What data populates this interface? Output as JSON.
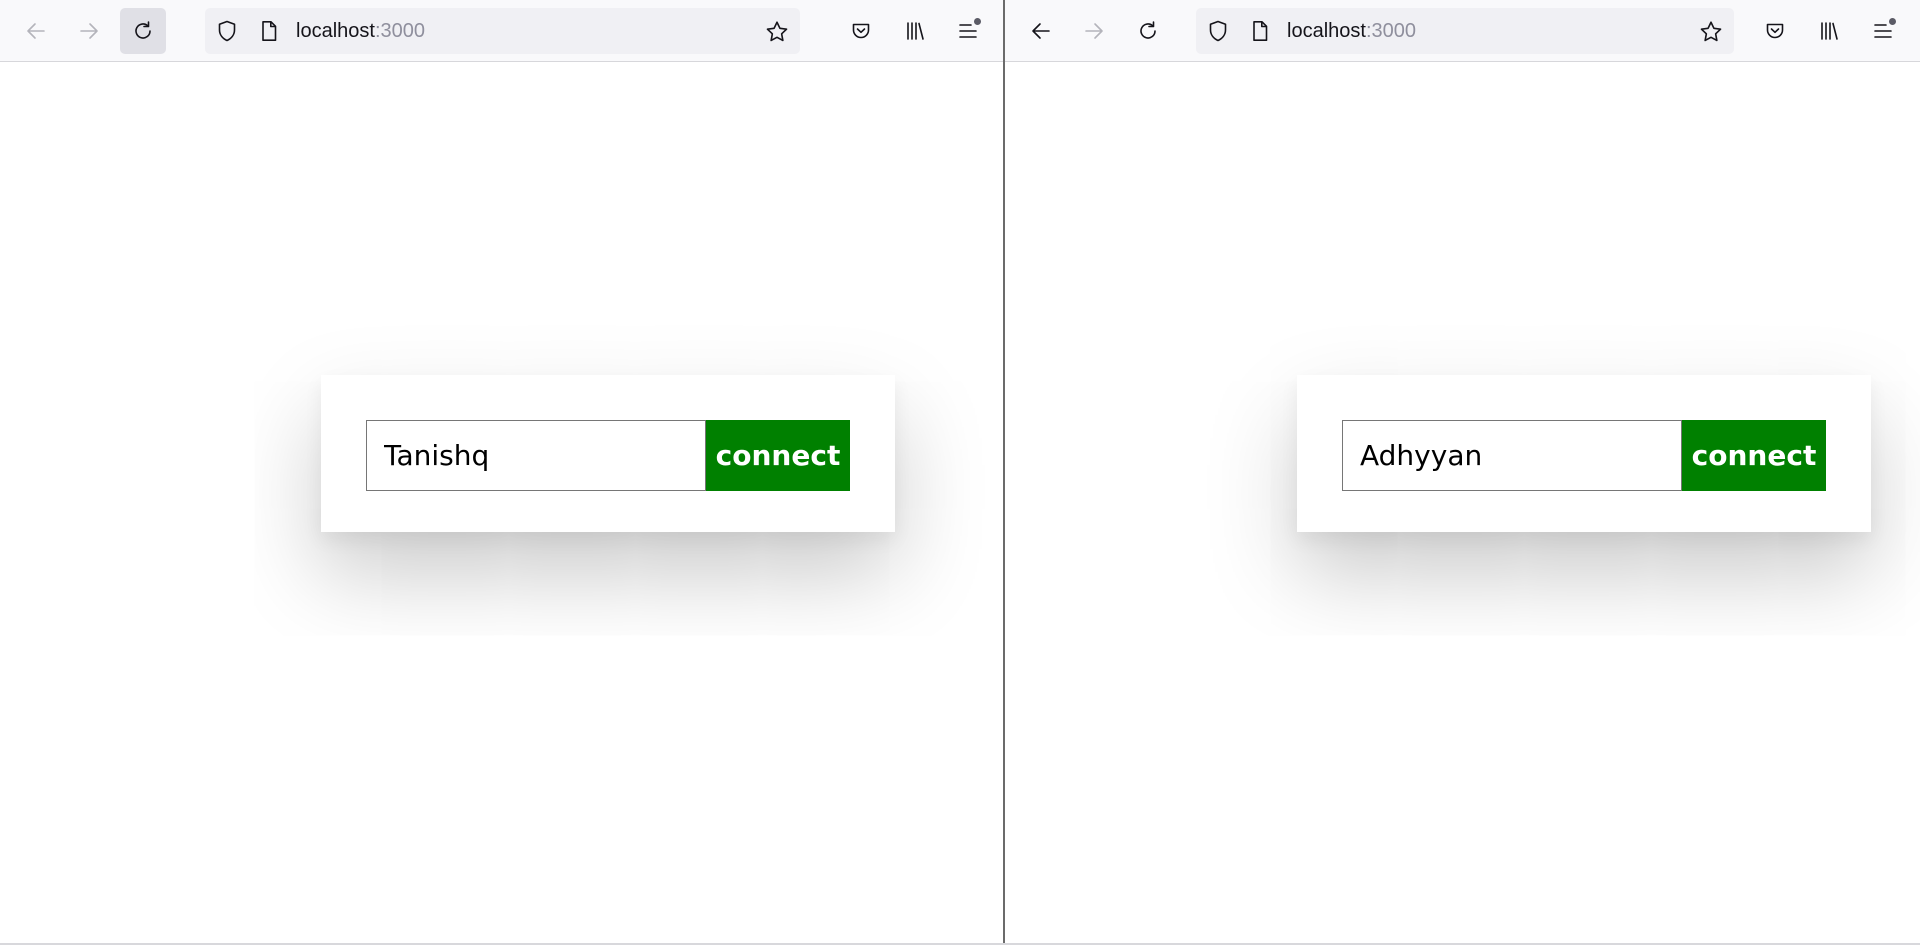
{
  "windows": [
    {
      "id": "left",
      "toolbar": {
        "back_enabled": false,
        "forward_enabled": false,
        "reload_active": true,
        "url_host": "localhost",
        "url_port": ":3000"
      },
      "form": {
        "name_value": "Tanishq",
        "connect_label": "connect"
      }
    },
    {
      "id": "right",
      "toolbar": {
        "back_enabled": true,
        "forward_enabled": false,
        "reload_active": false,
        "url_host": "localhost",
        "url_port": ":3000"
      },
      "form": {
        "name_value": "Adhyyan",
        "connect_label": "connect"
      }
    }
  ],
  "icons": {
    "back": "arrow-left-icon",
    "forward": "arrow-right-icon",
    "reload": "reload-icon",
    "tracking_protection": "shield-icon",
    "page_info": "page-icon",
    "bookmark": "star-icon",
    "pocket": "pocket-icon",
    "library": "library-icon",
    "menu": "hamburger-menu-icon"
  },
  "colors": {
    "connect_button": "#008000",
    "connect_text": "#ffffff",
    "toolbar_bg": "#f9f9fb",
    "urlbar_bg": "#f0f0f4",
    "icon_enabled": "#15141a",
    "icon_disabled": "#9e9ea6"
  }
}
